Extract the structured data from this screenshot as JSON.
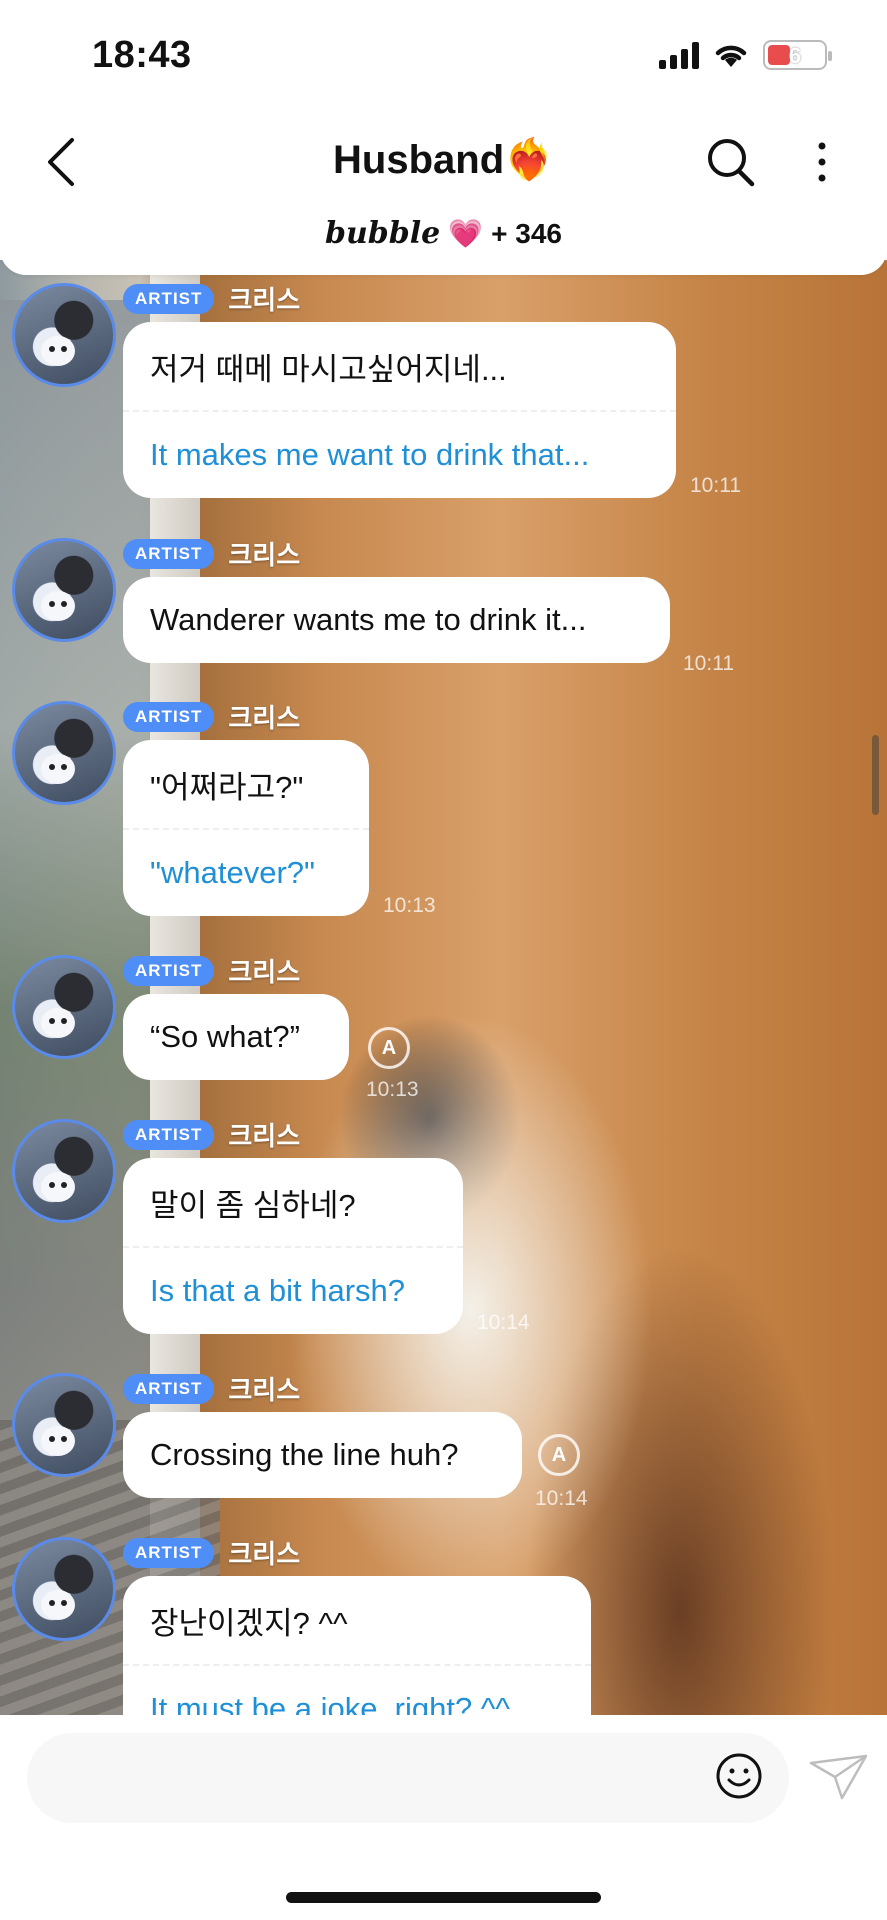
{
  "status_bar": {
    "time": "18:43",
    "battery": "6"
  },
  "header": {
    "title": "Husband❤️‍🔥",
    "brand": "bubble",
    "heart": "💗",
    "subscriber_count": "+ 346"
  },
  "messages": [
    {
      "badge": "ARTIST",
      "name": "크리스",
      "original": "저거 때메 마시고싶어지네...",
      "translation": "It makes me want to drink that...",
      "time": "10:11"
    },
    {
      "badge": "ARTIST",
      "name": "크리스",
      "original": "Wanderer wants me to drink it...",
      "translation": "",
      "time": "10:11"
    },
    {
      "badge": "ARTIST",
      "name": "크리스",
      "original": "\"어쩌라고?\"",
      "translation": "\"whatever?\"",
      "time": "10:13"
    },
    {
      "badge": "ARTIST",
      "name": "크리스",
      "original": "“So what?”",
      "translation": "",
      "time": "10:13"
    },
    {
      "badge": "ARTIST",
      "name": "크리스",
      "original": "말이 좀 심하네?",
      "translation": "Is that a bit harsh?",
      "time": "10:14"
    },
    {
      "badge": "ARTIST",
      "name": "크리스",
      "original": "Crossing the line huh?",
      "translation": "",
      "time": "10:14"
    },
    {
      "badge": "ARTIST",
      "name": "크리스",
      "original": "장난이겠지? ^^",
      "translation": "It must be a joke, right? ^^",
      "time": ""
    }
  ],
  "translate_icon": "A",
  "icons": [
    "back-chevron-icon",
    "search-icon",
    "more-vertical-icon",
    "emoji-icon",
    "send-icon"
  ]
}
